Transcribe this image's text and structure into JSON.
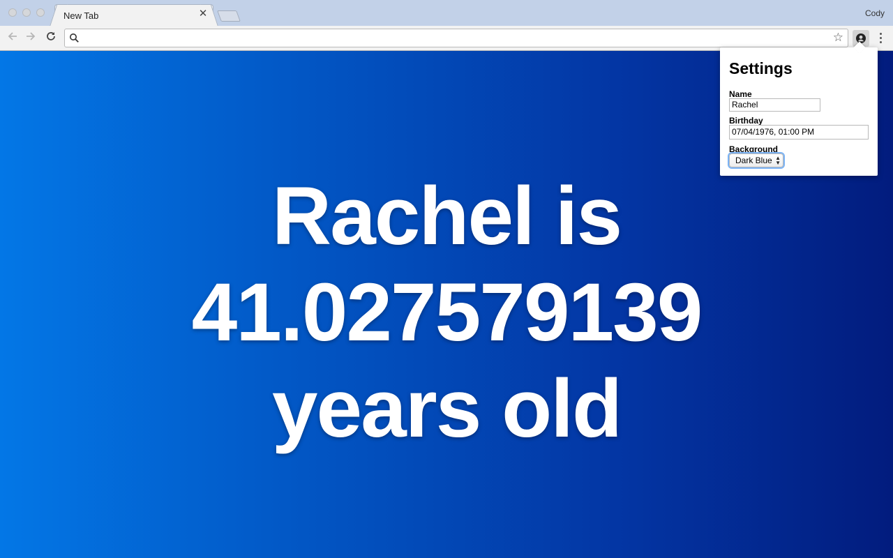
{
  "browser": {
    "tab_title": "New Tab",
    "tab_close_glyph": "✕",
    "profile_name": "Cody",
    "omnibox": {
      "value": "",
      "placeholder": ""
    },
    "icons": {
      "back": "arrow-left-icon",
      "forward": "arrow-right-icon",
      "reload": "reload-icon",
      "search": "search-icon",
      "bookmark": "star-icon",
      "extension": "account-circle-icon",
      "menu": "kebab-menu-icon"
    }
  },
  "page": {
    "age_line1": "Rachel is",
    "age_line2": "41.027579139",
    "age_line3": "years old",
    "background_gradient": [
      "#0377e6",
      "#021c7e"
    ]
  },
  "settings_popup": {
    "title": "Settings",
    "name_label": "Name",
    "name_value": "Rachel",
    "birthday_label": "Birthday",
    "birthday_value": "07/04/1976, 01:00 PM",
    "background_label": "Background",
    "background_value": "Dark Blue"
  }
}
